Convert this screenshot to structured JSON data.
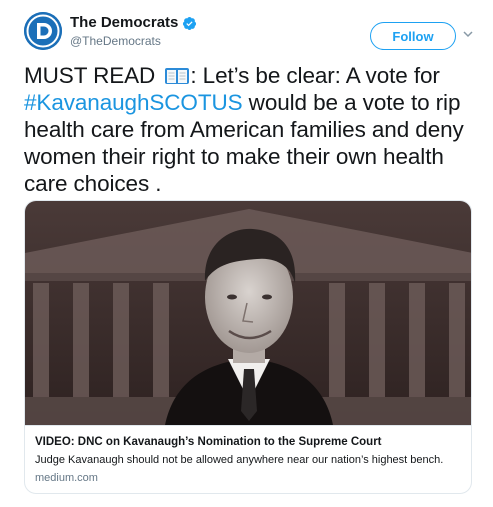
{
  "account": {
    "display_name": "The Democrats",
    "handle": "@TheDemocrats",
    "verified": true
  },
  "follow_button": {
    "label": "Follow"
  },
  "tweet": {
    "segments": [
      {
        "text": "MUST READ ",
        "hashtag": false
      },
      {
        "text": ": Let’s be clear: A vote for ",
        "hashtag": false
      },
      {
        "text": "#KavanaughSCOTUS",
        "hashtag": true
      },
      {
        "text": " would be a vote to rip health care from American families and deny women their right to make their own health care choices .",
        "hashtag": false
      }
    ],
    "emoji": "open-book-icon"
  },
  "card": {
    "title": "VIDEO: DNC on Kavanaugh’s Nomination to the Supreme Court",
    "description": "Judge Kavanaugh should not be allowed anywhere near our nation’s highest bench.",
    "domain": "medium.com"
  },
  "colors": {
    "accent": "#1da1f2",
    "hashtag": "#1b95e0",
    "avatar": "#1b6fb8",
    "card_background": "#3b2c2b"
  }
}
